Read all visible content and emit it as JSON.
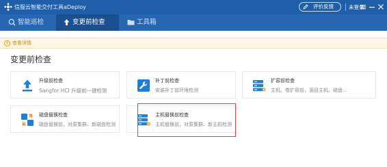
{
  "titlebar": {
    "app_title": "信服云智能交付工具aDeploy",
    "feedback_label": "评价反馈",
    "login_label": "未登录"
  },
  "nav": {
    "tabs": [
      {
        "label": "智能巡检",
        "icon": "inspect-icon",
        "active": false
      },
      {
        "label": "变更前检查",
        "icon": "upload-arrow-icon",
        "active": true
      },
      {
        "label": "工具箱",
        "icon": "folder-icon",
        "active": false
      }
    ]
  },
  "notice": {
    "text": "查看详情"
  },
  "page": {
    "section_title": "变更前检查"
  },
  "cards": [
    {
      "title": "升级前检查",
      "desc": "Sangfor HCI 升级前一键检测",
      "icon": "upgrade-arrow-icon"
    },
    {
      "title": "补丁前检查",
      "desc": "安装补丁前环境检测",
      "icon": "wrench-icon"
    },
    {
      "title": "扩容前检查",
      "desc": "主机、卷扩容前，源目主机、磁盘...",
      "icon": "server-expand-icon"
    },
    {
      "title": "磁盘替换检查",
      "desc": "磁盘替换前，对原集群、新磁盘检测",
      "icon": "disk-swap-icon"
    },
    {
      "title": "主机替换前检查",
      "desc": "主机替换前，对原集群、新主机检测",
      "icon": "server-swap-icon"
    }
  ],
  "colors": {
    "titlebar": "#1f5ea8",
    "navbar": "#2666b3",
    "nav_active": "#1b4f90",
    "notice_bg": "#fdf6e3",
    "notice_text": "#d4881a",
    "icon_blue": "#1e7fd6",
    "icon_orange": "#f08c1e",
    "highlight": "#e53b3b"
  }
}
